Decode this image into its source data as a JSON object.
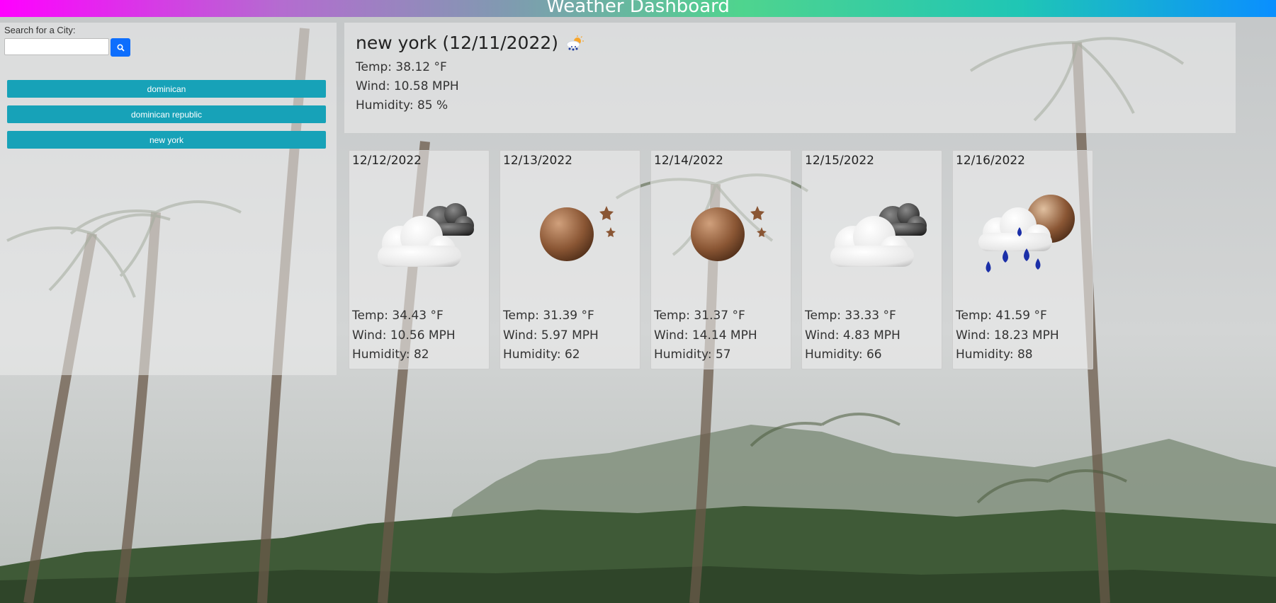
{
  "header": {
    "title": "Weather Dashboard"
  },
  "sidebar": {
    "search_label": "Search for a City:",
    "search_value": "",
    "search_icon": "search-icon",
    "history": [
      "dominican",
      "dominican republic",
      "new york"
    ]
  },
  "current": {
    "title": "new york (12/11/2022)",
    "icon": "snow-sun-icon",
    "temp": "Temp: 38.12 °F",
    "wind": "Wind: 10.58 MPH",
    "humidity": "Humidity: 85 %"
  },
  "forecast": [
    {
      "date": "12/12/2022",
      "icon": "cloud-night-icon",
      "temp": "Temp: 34.43 °F",
      "wind": "Wind: 10.56 MPH",
      "humidity": "Humidity: 82"
    },
    {
      "date": "12/13/2022",
      "icon": "moon-stars-icon",
      "temp": "Temp: 31.39 °F",
      "wind": "Wind: 5.97 MPH",
      "humidity": "Humidity: 62"
    },
    {
      "date": "12/14/2022",
      "icon": "moon-stars-icon",
      "temp": "Temp: 31.37 °F",
      "wind": "Wind: 14.14 MPH",
      "humidity": "Humidity: 57"
    },
    {
      "date": "12/15/2022",
      "icon": "cloud-night-icon",
      "temp": "Temp: 33.33 °F",
      "wind": "Wind: 4.83 MPH",
      "humidity": "Humidity: 66"
    },
    {
      "date": "12/16/2022",
      "icon": "rain-moon-icon",
      "temp": "Temp: 41.59 °F",
      "wind": "Wind: 18.23 MPH",
      "humidity": "Humidity: 88"
    }
  ],
  "colors": {
    "history_button": "#17a2b8",
    "search_button": "#0d6efd"
  }
}
